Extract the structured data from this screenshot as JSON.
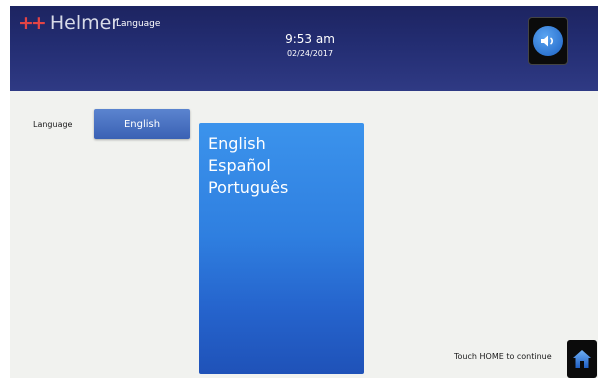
{
  "header": {
    "brand": "Helmer",
    "screen_title": "Language",
    "time": "9:53 am",
    "date": "02/24/2017",
    "sound_icon": "speaker-icon"
  },
  "settings": {
    "language_label": "Language",
    "selected_language": "English"
  },
  "language_options": [
    "English",
    "Español",
    "Português"
  ],
  "footer": {
    "hint": "Touch HOME to continue",
    "home_icon": "home-icon"
  },
  "colors": {
    "header_bg": "#232d72",
    "brand_mark": "#e34445",
    "accent_blue": "#2f7fe0",
    "background": "#f1f2ef"
  }
}
